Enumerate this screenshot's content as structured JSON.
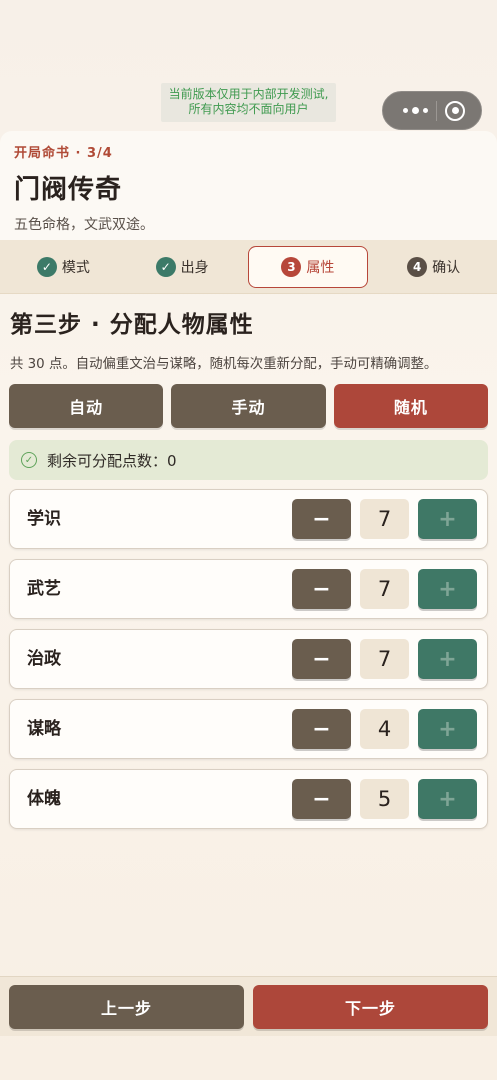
{
  "dev_notice": {
    "line1": "当前版本仅用于内部开发测试,",
    "line2": "所有内容均不面向用户"
  },
  "header": {
    "crumb": "开局命书 · 3/4",
    "title": "门阀传奇",
    "subtitle": "五色命格，文武双途。"
  },
  "stepper": [
    {
      "label": "模式",
      "badge": "✓",
      "state": "done"
    },
    {
      "label": "出身",
      "badge": "✓",
      "state": "done"
    },
    {
      "label": "属性",
      "badge": "3",
      "state": "current"
    },
    {
      "label": "确认",
      "badge": "4",
      "state": "upcoming"
    }
  ],
  "section": {
    "title": "第三步 · 分配人物属性",
    "desc": "共 30 点。自动偏重文治与谋略，随机每次重新分配，手动可精确调整。"
  },
  "modes": {
    "auto": "自动",
    "manual": "手动",
    "random": "随机"
  },
  "remaining": {
    "label": "剩余可分配点数：0"
  },
  "attributes": [
    {
      "name": "学识",
      "value": "7"
    },
    {
      "name": "武艺",
      "value": "7"
    },
    {
      "name": "治政",
      "value": "7"
    },
    {
      "name": "谋略",
      "value": "4"
    },
    {
      "name": "体魄",
      "value": "5"
    }
  ],
  "controls": {
    "minus": "−",
    "plus": "+"
  },
  "footer": {
    "prev": "上一步",
    "next": "下一步"
  },
  "colors": {
    "accent_red": "#ad473a",
    "dark_brown": "#6a5d4e",
    "teal": "#3f7866"
  }
}
